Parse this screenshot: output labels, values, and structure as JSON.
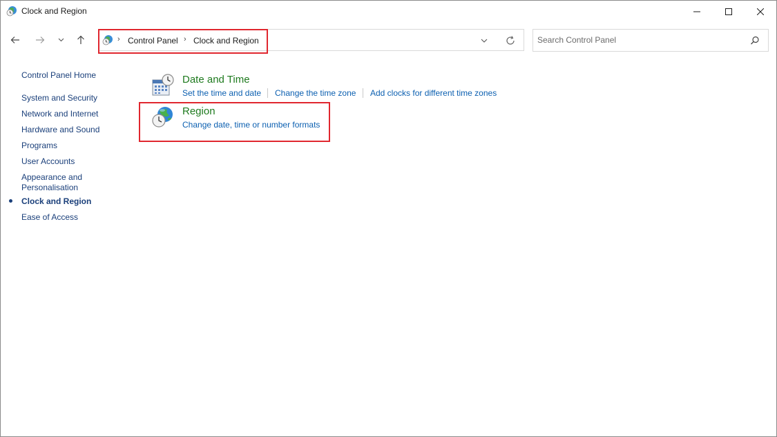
{
  "window": {
    "title": "Clock and Region",
    "icon": "clock-region-globe-icon"
  },
  "titlebar_buttons": {
    "minimize_icon": "minimize-icon",
    "maximize_icon": "maximize-icon",
    "close_icon": "close-icon"
  },
  "nav": {
    "back_icon": "arrow-left-icon",
    "forward_icon": "arrow-right-icon",
    "recent_icon": "chevron-down-icon",
    "up_icon": "arrow-up-icon"
  },
  "address": {
    "icon": "clock-region-globe-icon",
    "crumbs": [
      "Control Panel",
      "Clock and Region"
    ],
    "separator": "›",
    "dropdown_icon": "chevron-down-icon",
    "refresh_icon": "refresh-icon"
  },
  "search": {
    "placeholder": "Search Control Panel",
    "value": "",
    "icon": "search-icon"
  },
  "sidebar": {
    "home": "Control Panel Home",
    "items": [
      {
        "label": "System and Security"
      },
      {
        "label": "Network and Internet"
      },
      {
        "label": "Hardware and Sound"
      },
      {
        "label": "Programs"
      },
      {
        "label": "User Accounts"
      },
      {
        "label": "Appearance and"
      },
      {
        "label": "Personalisation"
      },
      {
        "label": "Clock and Region"
      },
      {
        "label": "Ease of Access"
      }
    ],
    "active_label": "Clock and Region"
  },
  "categories": [
    {
      "title": "Date and Time",
      "icon": "calendar-clock-icon",
      "links": [
        "Set the time and date",
        "Change the time zone",
        "Add clocks for different time zones"
      ]
    },
    {
      "title": "Region",
      "icon": "globe-clock-icon",
      "links": [
        "Change date, time or number formats"
      ]
    }
  ],
  "colors": {
    "highlight": "#e0262e",
    "category_title": "#1e7a1e",
    "task_link": "#0b5fb0",
    "sidebar_link": "#1a3f7a"
  }
}
